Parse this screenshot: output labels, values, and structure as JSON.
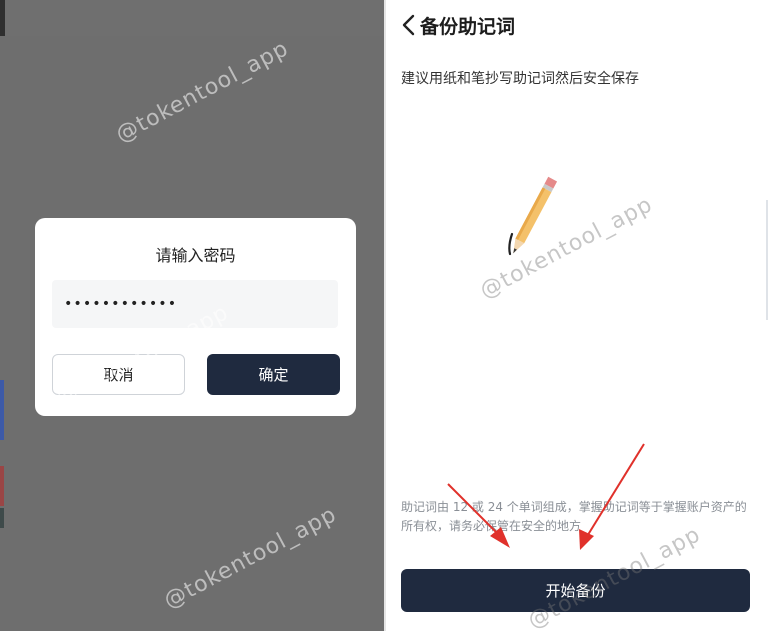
{
  "password_dialog": {
    "title": "请输入密码",
    "password_value": "••••••••••••",
    "cancel_label": "取消",
    "confirm_label": "确定"
  },
  "backup_page": {
    "back_icon": "chevron-left-icon",
    "title": "备份助记词",
    "tip": "建议用纸和笔抄写助记词然后安全保存",
    "illustration": "pencil-icon",
    "note": "助记词由 12 或 24 个单词组成，掌握助记词等于掌握账户资产的所有权，请务必保管在安全的地方",
    "start_button_label": "开始备份"
  },
  "annotations": {
    "arrow_color": "#e0312b",
    "arrow_icon": "arrow-icon"
  },
  "watermark": {
    "text": "@tokentool_app"
  },
  "colors": {
    "overlay": "#6e6e6e",
    "primary_button": "#1f2a3f",
    "input_bg": "#f5f6f7"
  }
}
